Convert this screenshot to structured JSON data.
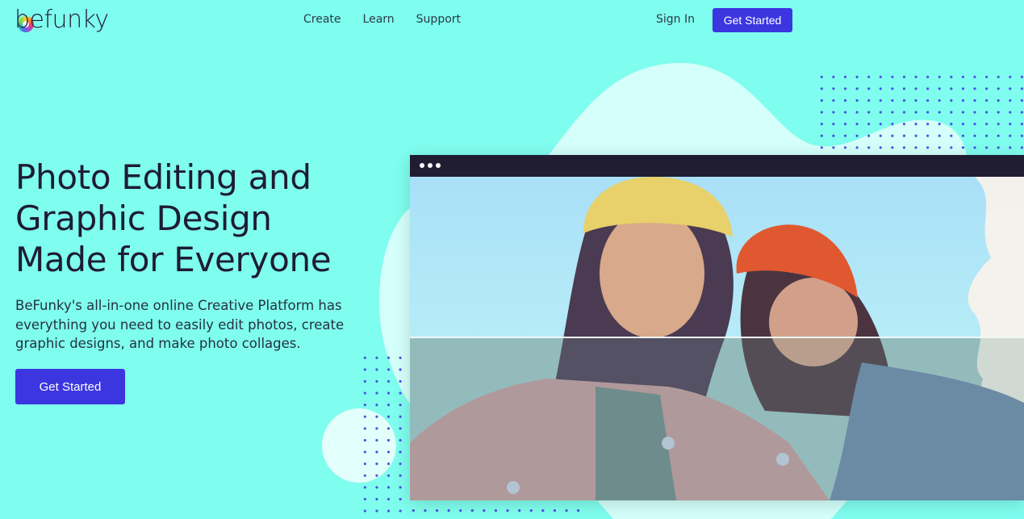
{
  "nav": {
    "logo_text": "befunky",
    "links": [
      {
        "label": "Create"
      },
      {
        "label": "Learn"
      },
      {
        "label": "Support"
      }
    ],
    "sign_in": "Sign In",
    "cta": "Get Started"
  },
  "hero": {
    "title_lines": [
      "Photo Editing and",
      "Graphic Design",
      "Made for Everyone"
    ],
    "description": "BeFunky's all-in-one online Creative Platform has everything you need to easily edit photos, create graphic designs, and make photo collages.",
    "cta": "Get Started"
  },
  "preview": {
    "window_dots_icon": "more-dots-icon",
    "image_alt": "Two young women in knit beanies and jackets, cartoonized photo effect with split comparison line"
  },
  "colors": {
    "background": "#7ffdee",
    "accent": "#3b36e0",
    "text": "#1e1c33",
    "blob": "#d4fffa",
    "window_bar": "#201d33",
    "dots": "#4a4fe0"
  }
}
